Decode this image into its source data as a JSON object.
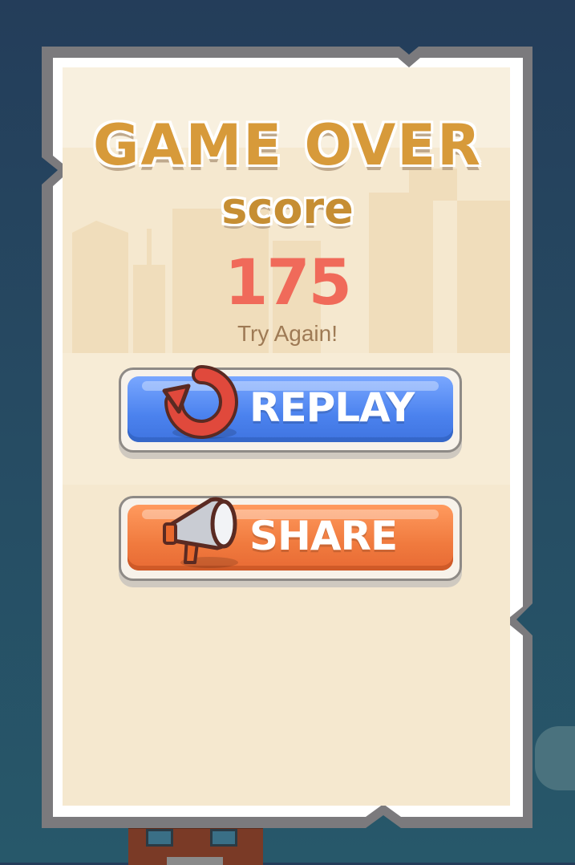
{
  "title": "GAME OVER",
  "score_label": "score",
  "score_value": "175",
  "message": "Try Again!",
  "buttons": {
    "replay": {
      "label": "REPLAY",
      "icon": "replay-arrow-icon"
    },
    "share": {
      "label": "SHARE",
      "icon": "megaphone-icon"
    }
  },
  "colors": {
    "title": "#d79a3a",
    "score_value": "#f06a5a",
    "replay_button": "#4b82ee",
    "share_button": "#f07a3e",
    "panel": "#f5e8cf"
  }
}
